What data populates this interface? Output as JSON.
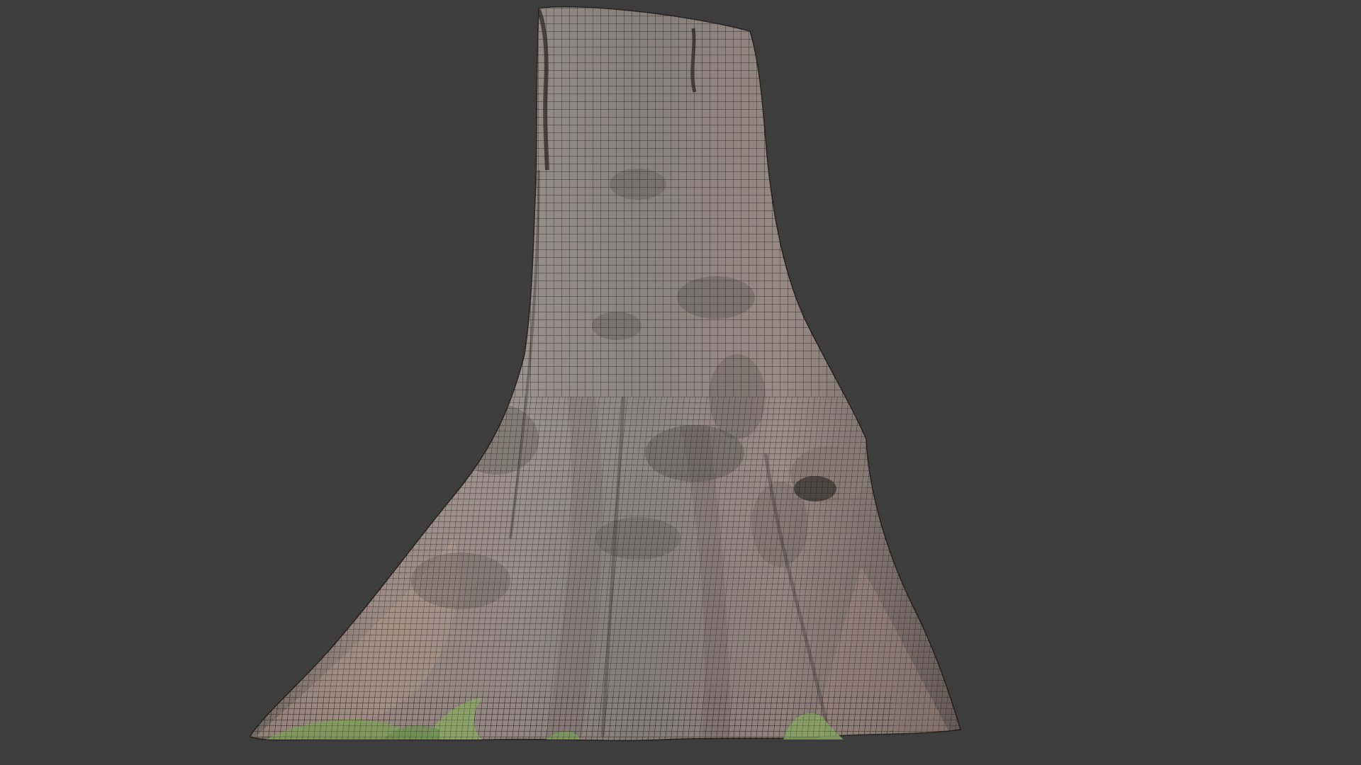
{
  "viewport": {
    "background_color": "#3d3d3d",
    "object": "tree-stump-mesh",
    "display_mode": "wireframe-over-textured",
    "colors": {
      "bark_light": "#a8998f",
      "bark_mid": "#8e827c",
      "bark_dark": "#5e5854",
      "bark_warm": "#b29a8c",
      "moss": "#7a9a5a",
      "wire": "#1e1a18"
    }
  }
}
